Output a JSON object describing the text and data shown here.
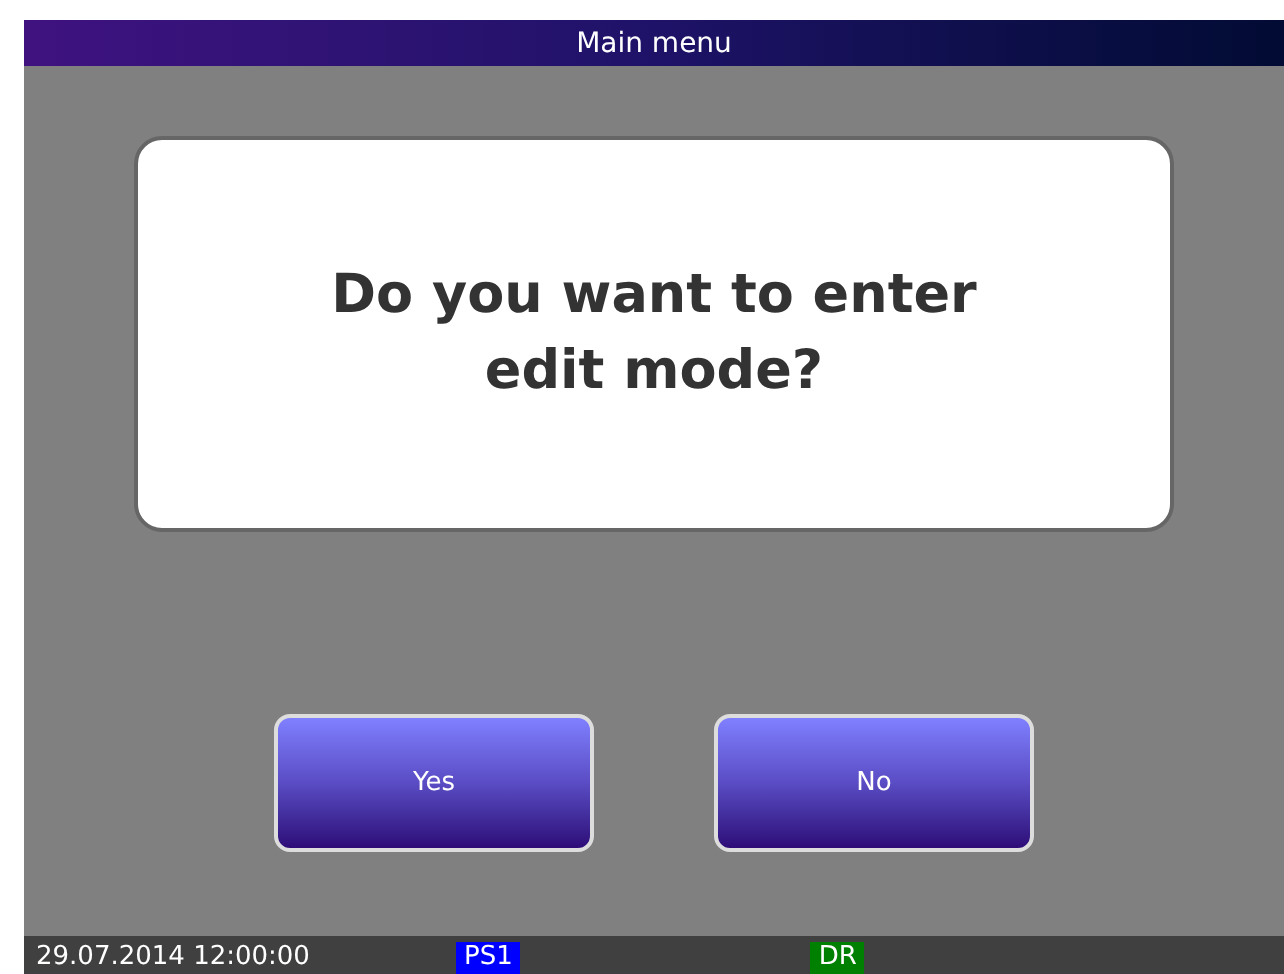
{
  "window": {
    "title": "Main menu"
  },
  "dialog": {
    "message": "Do you want to enter edit mode?"
  },
  "buttons": [
    {
      "label": "Yes"
    },
    {
      "label": "No"
    }
  ],
  "status_bar": {
    "datetime": "29.07.2014 12:00:00",
    "badges": [
      {
        "label": "PS1",
        "color": "#0000ff"
      },
      {
        "label": "DR",
        "color": "#008000"
      }
    ]
  }
}
